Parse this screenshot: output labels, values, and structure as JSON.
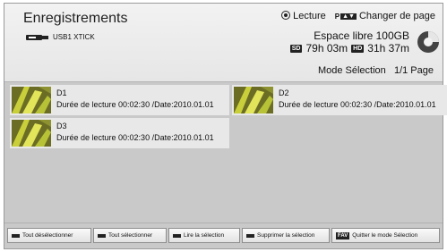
{
  "header": {
    "title": "Enregistrements",
    "usb_label": "USB1 XTICK",
    "play_label": "Lecture",
    "page_key": "P",
    "change_page_label": "Changer de page",
    "free_space_label": "Espace libre 100GB",
    "sd_tag": "SD",
    "sd_time": "79h 03m",
    "hd_tag": "HD",
    "hd_time": "31h 37m",
    "mode_label": "Mode Sélection",
    "page_indicator": "1/1 Page"
  },
  "recordings": [
    {
      "name": "D1",
      "info": "Durée de lecture 00:02:30 /Date:2010.01.01"
    },
    {
      "name": "D2",
      "info": "Durée de lecture 00:02:30 /Date:2010.01.01"
    },
    {
      "name": "D3",
      "info": "Durée de lecture 00:02:30 /Date:2010.01.01"
    }
  ],
  "footer": {
    "deselect_all": "Tout désélectionner",
    "select_all": "Tout sélectionner",
    "play_selection": "Lire la sélection",
    "delete_selection": "Supprimer la sélection",
    "fav_tag": "FAV",
    "quit_selection": "Quitter le mode Sélection"
  },
  "colors": {
    "background": "#c9c9c9",
    "header": "#eeeeee",
    "item": "#e8e8e8",
    "thumbnail_accent": "#b8c236"
  }
}
